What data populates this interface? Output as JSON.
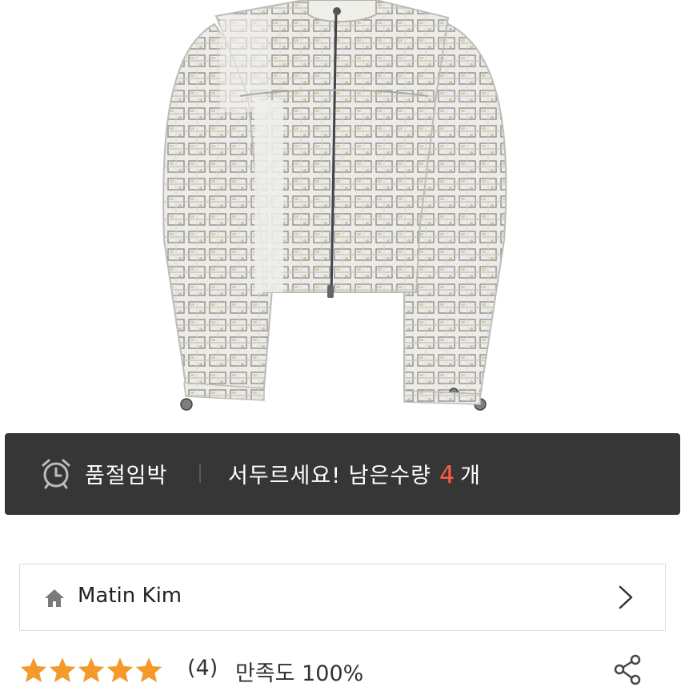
{
  "product": {
    "image_description_icon": "tweed-jacket-image"
  },
  "stock_banner": {
    "icon": "alarm-clock-icon",
    "urgent_label": "품절임박",
    "hurry_text": "서두르세요! 남은수량",
    "count": "4",
    "unit": "개",
    "background_color": "#363636",
    "count_color": "#ff5a45"
  },
  "brand": {
    "icon": "home-icon",
    "name": "Matin Kim",
    "chevron": "chevron-right-icon"
  },
  "rating": {
    "stars": 5,
    "max_stars": 5,
    "star_color": "#f39a2b",
    "review_count": "(4)",
    "satisfaction": "만족도 100%",
    "share_icon": "share-icon"
  }
}
